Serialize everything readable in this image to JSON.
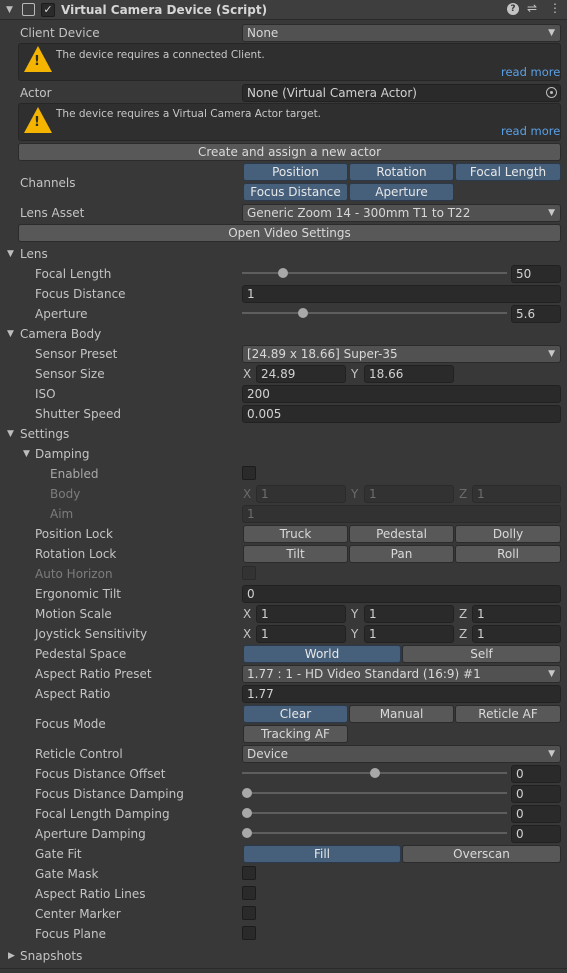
{
  "header": {
    "title": "Virtual Camera Device (Script)",
    "enabled": true,
    "icons": [
      "script-icon",
      "help-icon",
      "presets-icon",
      "more-icon"
    ]
  },
  "client_device": {
    "label": "Client Device",
    "value": "None"
  },
  "help_client": {
    "text": "The device requires a connected Client.",
    "link": "read more"
  },
  "actor": {
    "label": "Actor",
    "value": "None (Virtual Camera Actor)"
  },
  "help_actor": {
    "text": "The device requires a Virtual Camera Actor target.",
    "link": "read more"
  },
  "create_actor_button": "Create and assign a new actor",
  "channels": {
    "label": "Channels",
    "buttons": [
      "Position",
      "Rotation",
      "Focal Length",
      "Focus Distance",
      "Aperture"
    ]
  },
  "lens_asset": {
    "label": "Lens Asset",
    "value": "Generic Zoom 14 - 300mm T1 to T22"
  },
  "open_video_settings": "Open Video Settings",
  "lens": {
    "title": "Lens",
    "focal_length": {
      "label": "Focal Length",
      "value": "50",
      "fraction": 0.14
    },
    "focus_distance": {
      "label": "Focus Distance",
      "value": "1"
    },
    "aperture": {
      "label": "Aperture",
      "value": "5.6",
      "fraction": 0.22
    }
  },
  "camera_body": {
    "title": "Camera Body",
    "sensor_preset": {
      "label": "Sensor Preset",
      "value": "[24.89 x 18.66] Super-35"
    },
    "sensor_size": {
      "label": "Sensor Size",
      "x_label": "X",
      "x": "24.89",
      "y_label": "Y",
      "y": "18.66"
    },
    "iso": {
      "label": "ISO",
      "value": "200"
    },
    "shutter_speed": {
      "label": "Shutter Speed",
      "value": "0.005"
    }
  },
  "settings": {
    "title": "Settings",
    "damping": {
      "title": "Damping",
      "enabled_label": "Enabled",
      "body": {
        "label": "Body",
        "x": "1",
        "y": "1",
        "z": "1"
      },
      "aim": {
        "label": "Aim",
        "value": "1"
      }
    },
    "position_lock": {
      "label": "Position Lock",
      "buttons": [
        "Truck",
        "Pedestal",
        "Dolly"
      ]
    },
    "rotation_lock": {
      "label": "Rotation Lock",
      "buttons": [
        "Tilt",
        "Pan",
        "Roll"
      ]
    },
    "auto_horizon": {
      "label": "Auto Horizon"
    },
    "ergonomic_tilt": {
      "label": "Ergonomic Tilt",
      "value": "0"
    },
    "motion_scale": {
      "label": "Motion Scale",
      "x": "1",
      "y": "1",
      "z": "1"
    },
    "joystick_sensitivity": {
      "label": "Joystick Sensitivity",
      "x": "1",
      "y": "1",
      "z": "1"
    },
    "pedestal_space": {
      "label": "Pedestal Space",
      "buttons": [
        "World",
        "Self"
      ]
    },
    "aspect_ratio_preset": {
      "label": "Aspect Ratio Preset",
      "value": "1.77 : 1 - HD Video Standard (16:9) #1"
    },
    "aspect_ratio": {
      "label": "Aspect Ratio",
      "value": "1.77"
    },
    "focus_mode": {
      "label": "Focus Mode",
      "buttons": [
        "Clear",
        "Manual",
        "Reticle AF",
        "Tracking AF"
      ]
    },
    "reticle_control": {
      "label": "Reticle Control",
      "value": "Device"
    },
    "focus_distance_offset": {
      "label": "Focus Distance Offset",
      "value": "0",
      "fraction": 0.5
    },
    "focus_distance_damping": {
      "label": "Focus Distance Damping",
      "value": "0",
      "fraction": 0.0
    },
    "focal_length_damping": {
      "label": "Focal Length Damping",
      "value": "0",
      "fraction": 0.0
    },
    "aperture_damping": {
      "label": "Aperture Damping",
      "value": "0",
      "fraction": 0.0
    },
    "gate_fit": {
      "label": "Gate Fit",
      "buttons": [
        "Fill",
        "Overscan"
      ]
    },
    "gate_mask": {
      "label": "Gate Mask"
    },
    "aspect_ratio_lines": {
      "label": "Aspect Ratio Lines"
    },
    "center_marker": {
      "label": "Center Marker"
    },
    "focus_plane": {
      "label": "Focus Plane"
    }
  },
  "snapshots": {
    "title": "Snapshots"
  },
  "axis_labels": {
    "x": "X",
    "y": "Y",
    "z": "Z"
  }
}
